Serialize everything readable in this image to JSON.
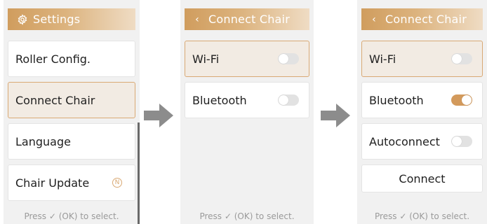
{
  "screens": [
    {
      "header": {
        "title": "Settings",
        "icon": "gear-icon"
      },
      "items": [
        {
          "label": "Roller Config.",
          "selected": false
        },
        {
          "label": "Connect Chair",
          "selected": true
        },
        {
          "label": "Language",
          "selected": false
        },
        {
          "label": "Chair Update",
          "selected": false,
          "badge": "N"
        }
      ],
      "footer": "Press ✓ (OK) to select."
    },
    {
      "header": {
        "title": "Connect Chair",
        "icon": "chevron-left-icon"
      },
      "items": [
        {
          "label": "Wi-Fi",
          "selected": true,
          "toggle": false
        },
        {
          "label": "Bluetooth",
          "selected": false,
          "toggle": false
        }
      ],
      "footer": "Press ✓ (OK) to select."
    },
    {
      "header": {
        "title": "Connect Chair",
        "icon": "chevron-left-icon"
      },
      "items": [
        {
          "label": "Wi-Fi",
          "selected": true,
          "toggle": false
        },
        {
          "label": "Bluetooth",
          "selected": false,
          "toggle": true
        },
        {
          "label": "Autoconnect",
          "selected": false,
          "toggle": false
        },
        {
          "label": "Connect",
          "selected": false
        }
      ],
      "footer": "Press ✓ (OK) to select."
    }
  ],
  "arrows": [
    "arrow-right-icon",
    "arrow-right-icon"
  ],
  "colors": {
    "accent": "#d39a5c",
    "header_gradient_start": "#d09d5e",
    "header_gradient_end": "#efdcc4",
    "selected_background": "#f2ebe3",
    "selected_border": "#d9a974",
    "screen_background": "#f1f1f1",
    "footer_text": "#9a9a9a"
  }
}
